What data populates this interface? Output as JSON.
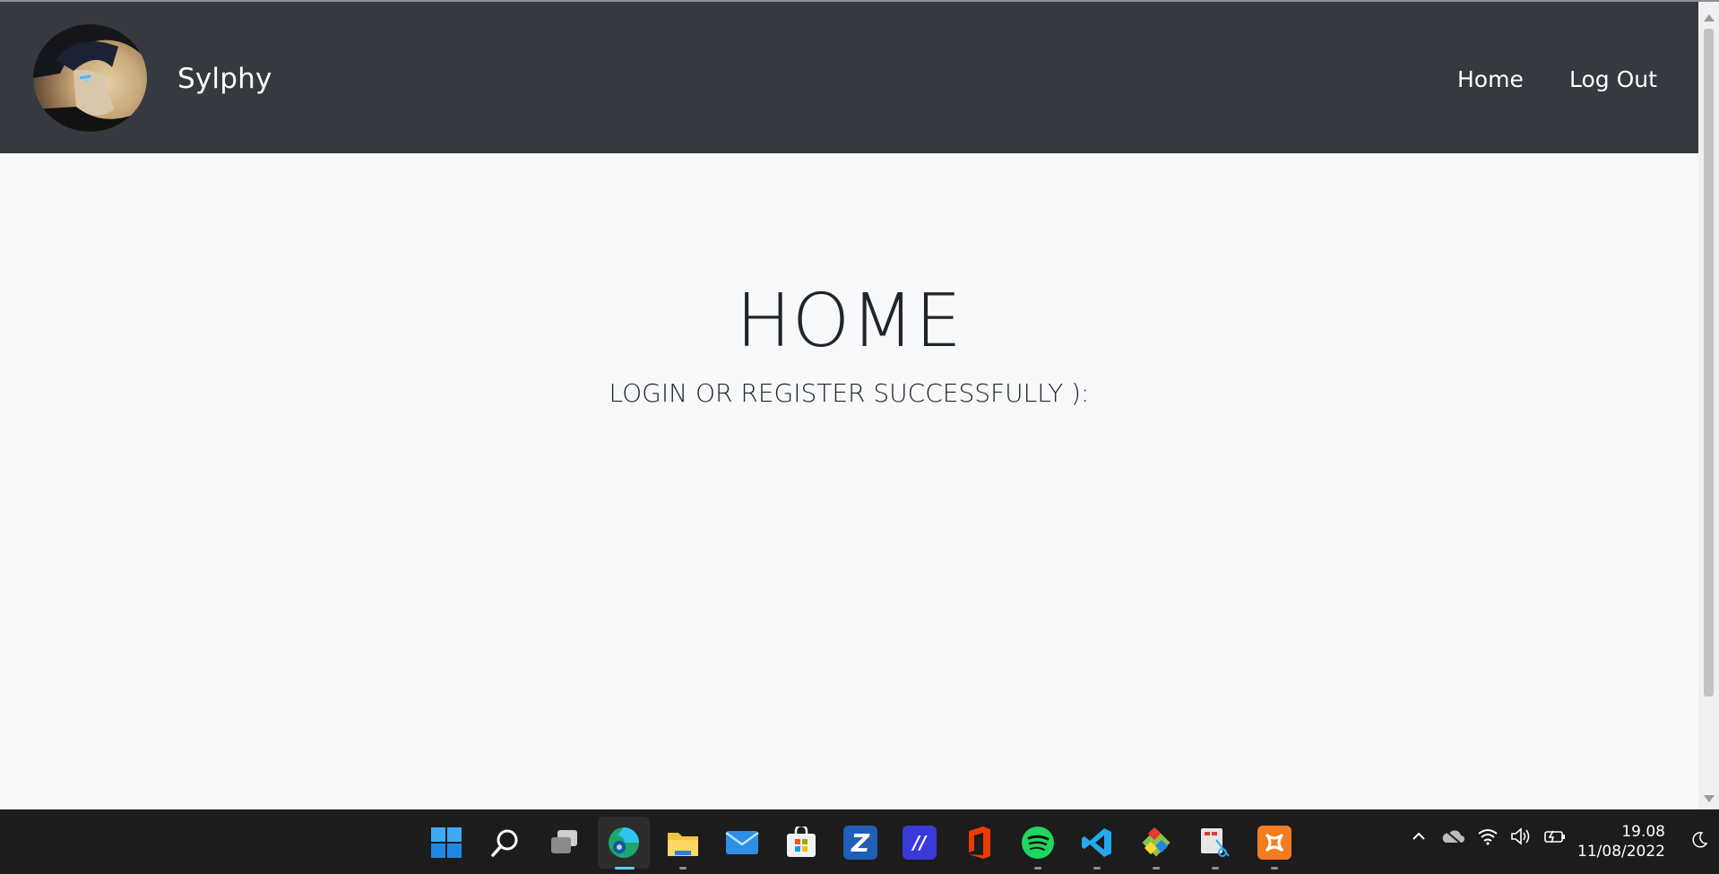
{
  "navbar": {
    "brand": "Sylphy",
    "links": {
      "home": "Home",
      "logout": "Log Out"
    }
  },
  "main": {
    "title": "HOME",
    "subtitle": "LOGIN OR REGISTER SUCCESSFULLY ):"
  },
  "taskbar": {
    "apps": [
      "windows-start-icon",
      "search-icon",
      "task-view-icon",
      "edge-browser-icon",
      "file-explorer-icon",
      "mail-icon",
      "microsoft-store-icon",
      "app-z-icon",
      "app-ma-icon",
      "office-icon",
      "spotify-icon",
      "vscode-icon",
      "git-icon",
      "snipping-tool-icon",
      "xampp-icon"
    ],
    "clock": {
      "time": "19.08",
      "date": "11/08/2022"
    }
  },
  "colors": {
    "navbar_bg": "#343a40",
    "page_bg": "#f8f9fa",
    "taskbar_bg": "#1c1c1c",
    "accent": "#60cdff"
  }
}
